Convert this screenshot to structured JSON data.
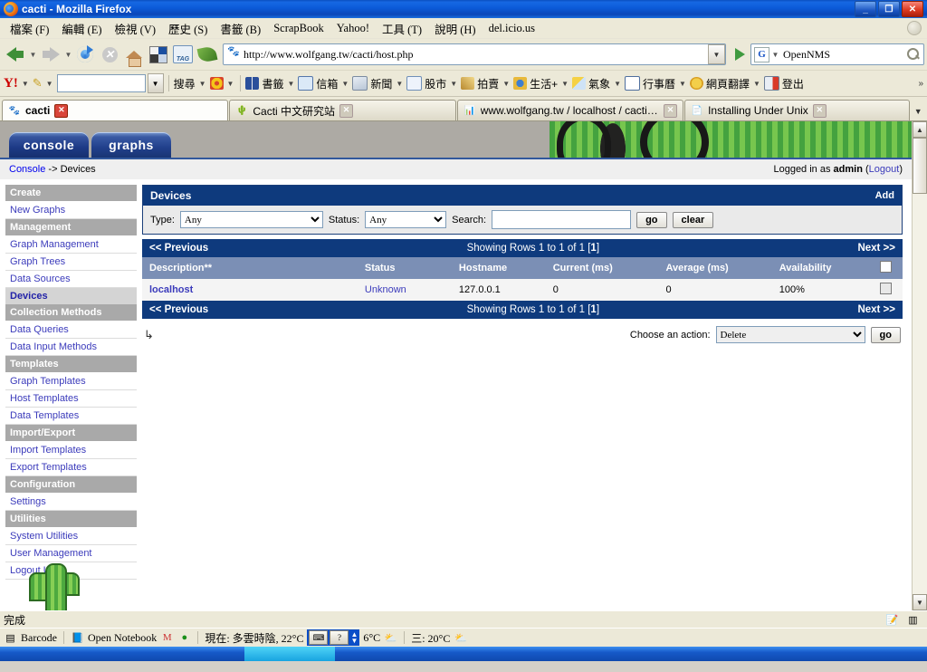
{
  "window": {
    "title": "cacti - Mozilla Firefox",
    "minimize": "_",
    "maximize": "❐",
    "close": "✕"
  },
  "menubar": {
    "items": [
      "檔案 (F)",
      "編輯 (E)",
      "檢視 (V)",
      "歷史 (S)",
      "書籤 (B)",
      "ScrapBook",
      "Yahoo!",
      "工具 (T)",
      "說明 (H)",
      "del.icio.us"
    ]
  },
  "navbar": {
    "url": "http://www.wolfgang.tw/cacti/host.php",
    "search_value": "OpenNMS",
    "search_engine": "G"
  },
  "yahoobar": {
    "logo": "Y!",
    "search_box_value": "",
    "search_label": "搜尋",
    "items": [
      {
        "label": "書籤",
        "icon": "book-icon"
      },
      {
        "label": "信箱",
        "icon": "mail-icon"
      },
      {
        "label": "新聞",
        "icon": "news-icon"
      },
      {
        "label": "股市",
        "icon": "stock-icon"
      },
      {
        "label": "拍賣",
        "icon": "auction-icon"
      },
      {
        "label": "生活+",
        "icon": "life-icon"
      },
      {
        "label": "氣象",
        "icon": "weather-icon"
      },
      {
        "label": "行事曆",
        "icon": "calendar-icon"
      },
      {
        "label": "網頁翻譯",
        "icon": "translate-icon"
      },
      {
        "label": "登出",
        "icon": "logout-icon"
      }
    ],
    "overflow": "»"
  },
  "tabs": [
    {
      "label": "cacti",
      "active": true,
      "favicon": "paw-icon"
    },
    {
      "label": "Cacti 中文研究站",
      "active": false,
      "favicon": "cacti-icon"
    },
    {
      "label": "www.wolfgang.tw / localhost / cacti | ph...",
      "active": false,
      "favicon": "pma-icon"
    },
    {
      "label": "Installing Under Unix",
      "active": false,
      "favicon": "page-icon"
    }
  ],
  "cacti": {
    "tabs": [
      {
        "label": "console",
        "active": true
      },
      {
        "label": "graphs",
        "active": false
      }
    ],
    "breadcrumb_link": "Console",
    "breadcrumb_sep": " -> ",
    "breadcrumb_current": "Devices",
    "login_prefix": "Logged in as ",
    "login_user": "admin",
    "logout_open": " (",
    "logout_label": "Logout",
    "logout_close": ")"
  },
  "sidebar": {
    "groups": [
      {
        "header": "Create",
        "items": [
          {
            "label": "New Graphs",
            "selected": false
          }
        ]
      },
      {
        "header": "Management",
        "items": [
          {
            "label": "Graph Management",
            "selected": false
          },
          {
            "label": "Graph Trees",
            "selected": false
          },
          {
            "label": "Data Sources",
            "selected": false
          },
          {
            "label": "Devices",
            "selected": true
          }
        ]
      },
      {
        "header": "Collection Methods",
        "items": [
          {
            "label": "Data Queries",
            "selected": false
          },
          {
            "label": "Data Input Methods",
            "selected": false
          }
        ]
      },
      {
        "header": "Templates",
        "items": [
          {
            "label": "Graph Templates",
            "selected": false
          },
          {
            "label": "Host Templates",
            "selected": false
          },
          {
            "label": "Data Templates",
            "selected": false
          }
        ]
      },
      {
        "header": "Import/Export",
        "items": [
          {
            "label": "Import Templates",
            "selected": false
          },
          {
            "label": "Export Templates",
            "selected": false
          }
        ]
      },
      {
        "header": "Configuration",
        "items": [
          {
            "label": "Settings",
            "selected": false
          }
        ]
      },
      {
        "header": "Utilities",
        "items": [
          {
            "label": "System Utilities",
            "selected": false
          },
          {
            "label": "User Management",
            "selected": false
          },
          {
            "label": "Logout User",
            "selected": false
          }
        ]
      }
    ]
  },
  "devices": {
    "panel_title": "Devices",
    "add_label": "Add",
    "filter": {
      "type_label": "Type:",
      "type_value": "Any",
      "status_label": "Status:",
      "status_value": "Any",
      "search_label": "Search:",
      "search_value": "",
      "search_placeholder": "",
      "go_label": "go",
      "clear_label": "clear"
    },
    "pager": {
      "previous": "<< Previous",
      "showing_prefix": "Showing Rows 1 to 1 of 1 [",
      "showing_page": "1",
      "showing_suffix": "]",
      "next": "Next >>"
    },
    "columns": [
      "Description**",
      "Status",
      "Hostname",
      "Current (ms)",
      "Average (ms)",
      "Availability"
    ],
    "rows": [
      {
        "description": "localhost",
        "status": "Unknown",
        "hostname": "127.0.0.1",
        "current_ms": "0",
        "average_ms": "0",
        "availability": "100%",
        "checked": false
      }
    ],
    "action": {
      "label": "Choose an action:",
      "value": "Delete",
      "go_label": "go"
    }
  },
  "statusbar": {
    "text": "完成"
  },
  "approw": {
    "barcode_label": "Barcode",
    "notebook_label": "Open Notebook",
    "weather_now": "現在: 多雲時陰, 22°C",
    "weather_temp2": "6°C",
    "weather_forecast": "三: 20°C",
    "ime_keyboard": "⌨",
    "ime_help": "?"
  },
  "colors": {
    "title_blue": "#0b5ad8",
    "cacti_header_blue": "#0e3a7d",
    "table_header": "#7b8fb5",
    "link_blue": "#3b3bbb",
    "selected_menu": "#d4d4d4"
  }
}
